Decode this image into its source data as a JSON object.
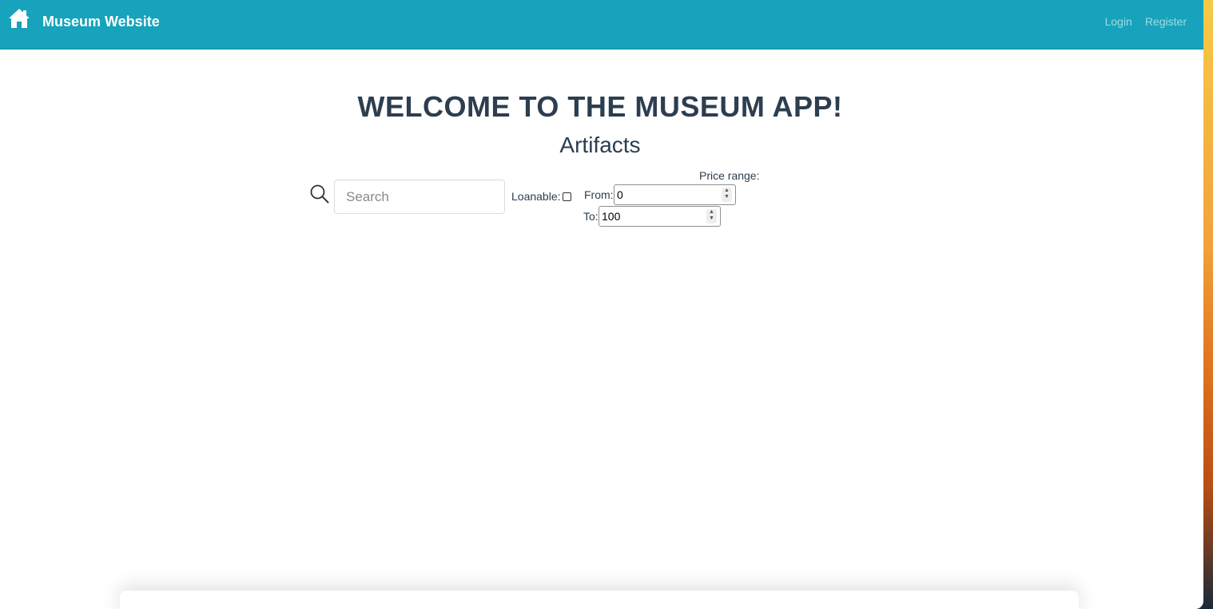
{
  "navbar": {
    "brand": "Museum Website",
    "login": "Login",
    "register": "Register",
    "home_icon": "home-icon",
    "color": "#16a3bb"
  },
  "main": {
    "title": "WELCOME TO THE MUSEUM APP!",
    "subtitle": "Artifacts"
  },
  "filters": {
    "search_icon": "search-icon",
    "search_placeholder": "Search",
    "search_value": "",
    "loanable_label": "Loanable:",
    "loanable_checked": false,
    "price_range_label": "Price range:",
    "from_label": "From:",
    "from_value": "0",
    "to_label": "To:",
    "to_value": "100"
  }
}
